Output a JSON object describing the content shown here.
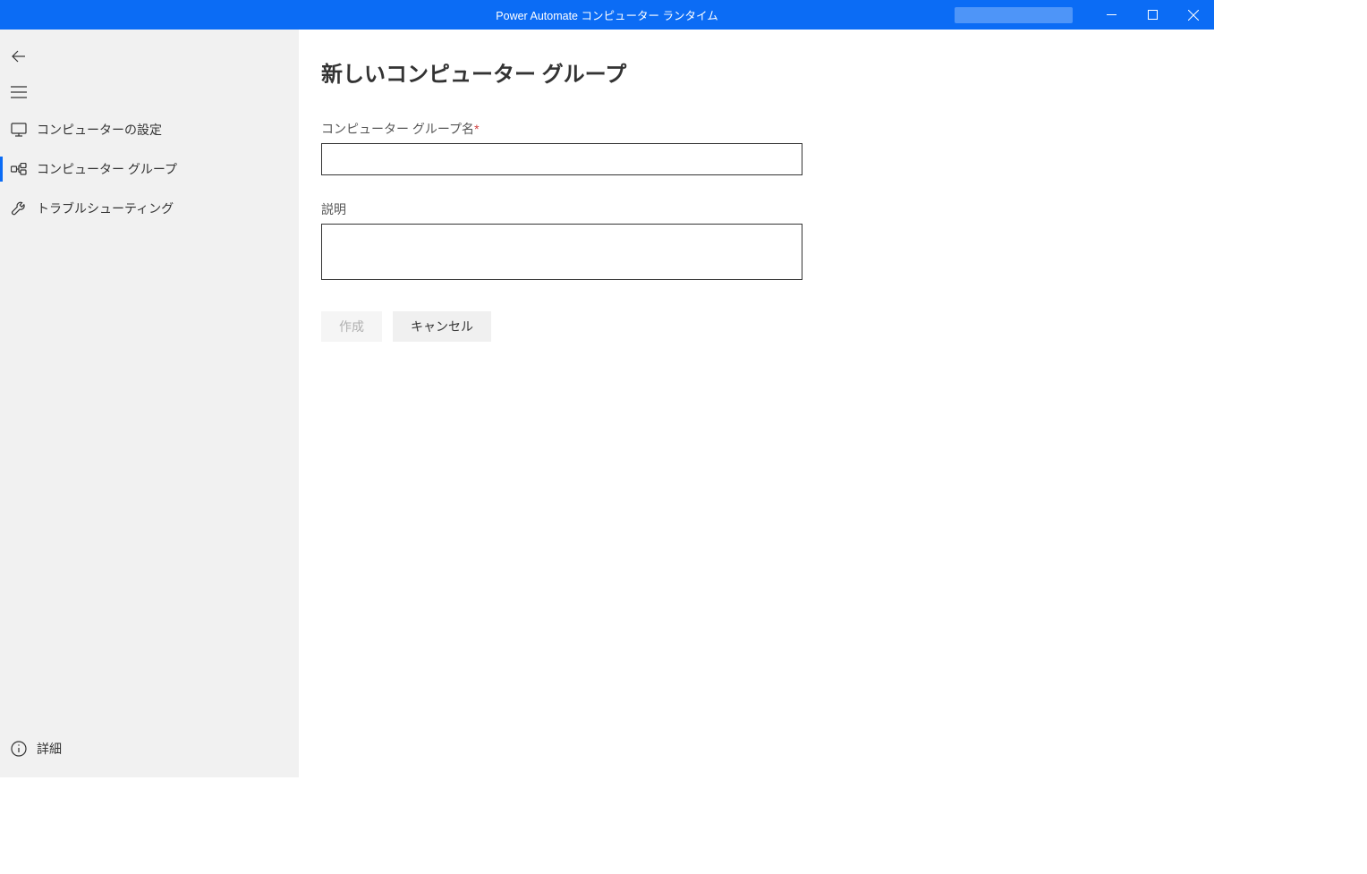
{
  "titlebar": {
    "title": "Power Automate コンピューター ランタイム"
  },
  "sidebar": {
    "items": [
      {
        "label": "コンピューターの設定"
      },
      {
        "label": "コンピューター グループ"
      },
      {
        "label": "トラブルシューティング"
      }
    ],
    "bottom": {
      "label": "詳細"
    }
  },
  "main": {
    "page_title": "新しいコンピューター グループ",
    "field_name_label": "コンピューター グループ名",
    "field_name_required": "*",
    "field_desc_label": "説明",
    "create_button": "作成",
    "cancel_button": "キャンセル"
  }
}
